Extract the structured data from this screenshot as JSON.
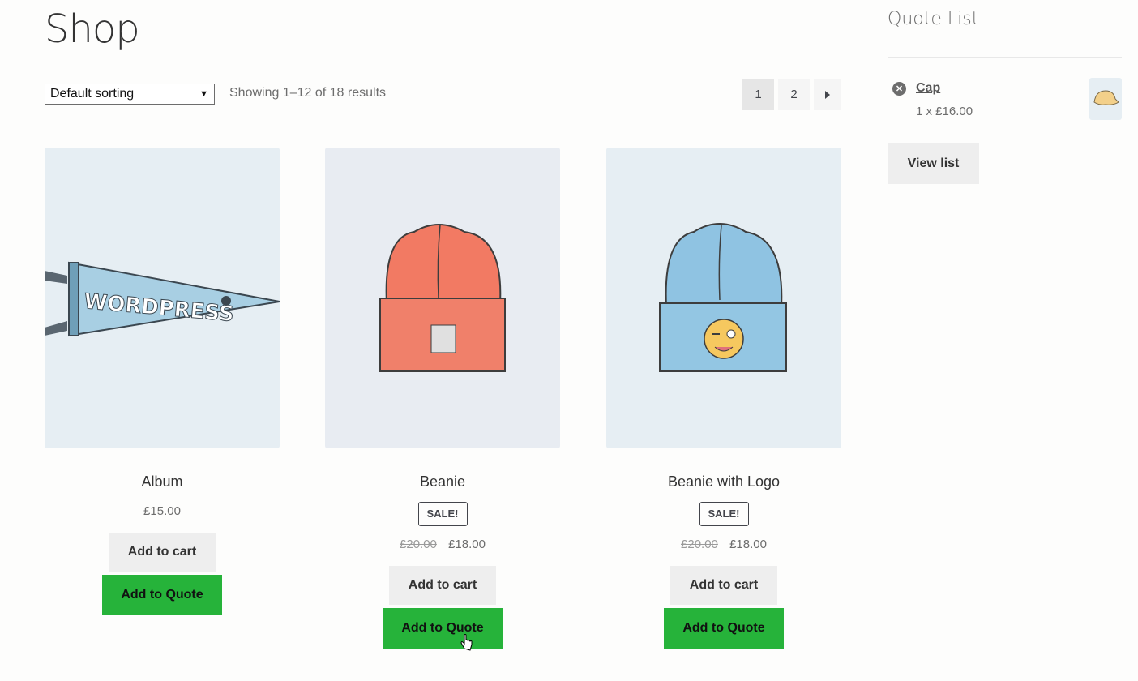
{
  "page": {
    "title": "Shop"
  },
  "toolbar": {
    "sorting": "Default sorting",
    "result_count": "Showing 1–12 of 18 results",
    "pagination": [
      "1",
      "2"
    ],
    "next_icon": "caret-right-icon"
  },
  "products": [
    {
      "name": "Album",
      "price": "£15.00",
      "cart_label": "Add to cart",
      "quote_label": "Add to Quote",
      "image": "wordpress-pennant",
      "image_text": "WORDPRESS"
    },
    {
      "name": "Beanie",
      "sale_label": "SALE!",
      "old_price": "£20.00",
      "price": "£18.00",
      "cart_label": "Add to cart",
      "quote_label": "Add to Quote",
      "image": "orange-beanie"
    },
    {
      "name": "Beanie with Logo",
      "sale_label": "SALE!",
      "old_price": "£20.00",
      "price": "£18.00",
      "cart_label": "Add to cart",
      "quote_label": "Add to Quote",
      "image": "blue-beanie-with-emoji"
    }
  ],
  "sidebar": {
    "title": "Quote List",
    "items": [
      {
        "name": "Cap",
        "qty": "1 x £16.00",
        "image": "cap"
      }
    ],
    "view_list_label": "View list"
  },
  "colors": {
    "quote_button": "#26b33a",
    "cart_button": "#eeeeee",
    "thumb_bg": "#e6eef3"
  }
}
